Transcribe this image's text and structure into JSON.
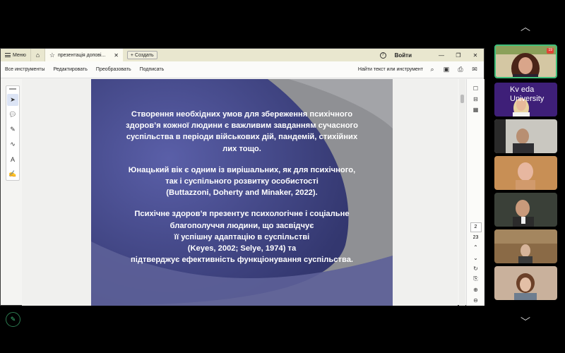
{
  "acrobat": {
    "menu_label": "Меню",
    "tab_title": "презентація допові...",
    "create_label": "Создать",
    "signin_label": "Войти",
    "toolbar": [
      "Все инструменты",
      "Редактировать",
      "Преобразовать",
      "Подписать"
    ],
    "search_label": "Найти текст или инструмент"
  },
  "slide": {
    "paragraphs": [
      "Створення необхідних умов для збереження психічного\nздоров’я кожної людини є важливим завданням сучасного\nсуспільства в періоди військових дій, пандемій, стихійних\nлих тощо.",
      "Юнацький вік є одним із вирішальних, як для психічного,\nтак і суспільного розвитку особистості\n(Buttazzoni, Doherty and Minaker, 2022).",
      "Психічне здоров’я презентує психологічне і соціальне\nблагополуччя людини, що засвідчує\nїї успішну адаптацію в суспільстві\n(Keyes, 2002; Selye, 1974) та\nпідтверджує ефективність функціонування суспільства."
    ]
  },
  "pagination": {
    "current": "2",
    "total": "23"
  },
  "participants": {
    "badge": "19",
    "logo_lines": [
      "Kv eda",
      "University"
    ]
  },
  "colors": {
    "accent_green": "#3fbf7a",
    "slide_blue": "#4a4f8f",
    "menubar": "#e9e7cf"
  }
}
